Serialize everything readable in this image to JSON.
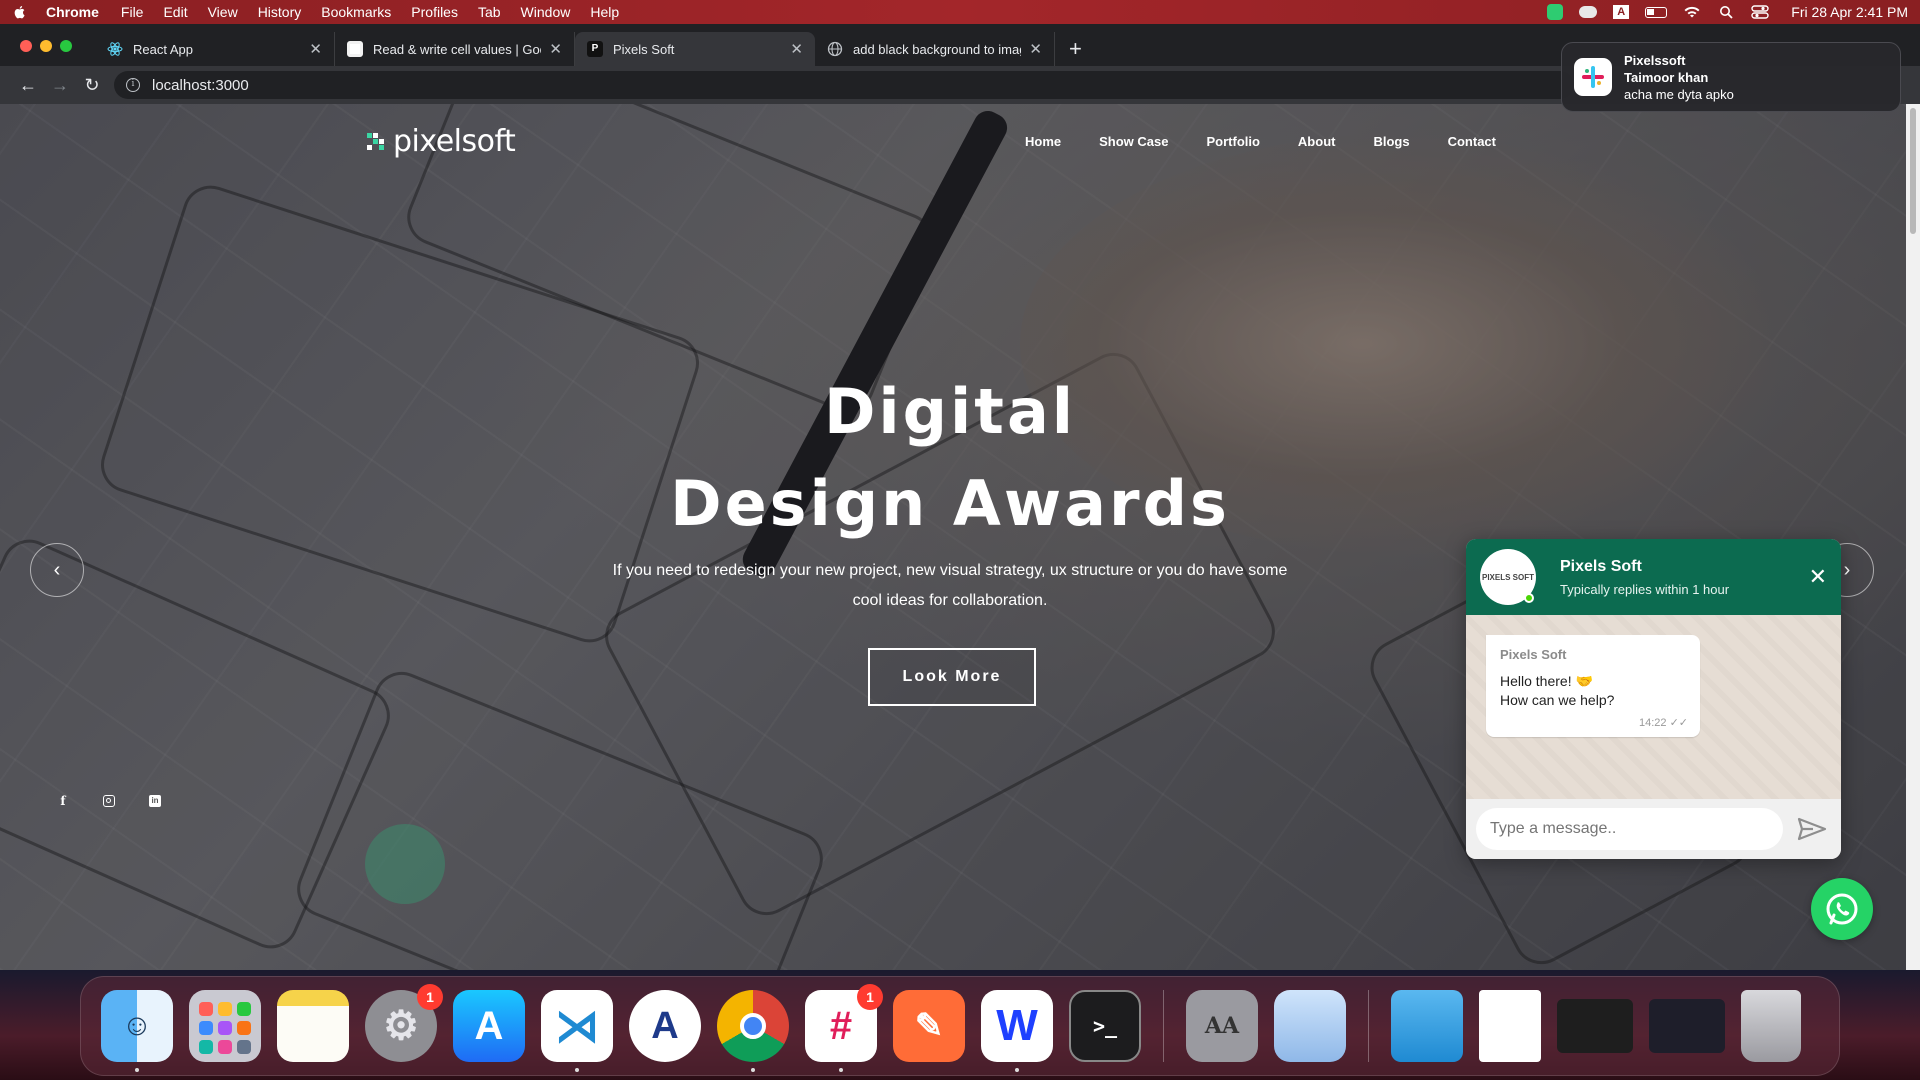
{
  "menubar": {
    "app_name": "Chrome",
    "menu_items": [
      "File",
      "Edit",
      "View",
      "History",
      "Bookmarks",
      "Profiles",
      "Tab",
      "Window",
      "Help"
    ],
    "clock": "Fri 28 Apr  2:41 PM"
  },
  "browser": {
    "tabs": [
      {
        "title": "React App",
        "icon": "react-icon"
      },
      {
        "title": "Read & write cell values  |  Goo",
        "icon": "sheets-icon"
      },
      {
        "title": "Pixels Soft",
        "icon": "pixelsoft-icon"
      },
      {
        "title": "add black background to image",
        "icon": "globe-icon"
      }
    ],
    "active_tab": 2,
    "url": "localhost:3000"
  },
  "notification": {
    "app": "Pixelssoft",
    "sender": "Taimoor khan",
    "message": "acha me dyta apko"
  },
  "site": {
    "logo_text": "pixelsoft",
    "nav": [
      "Home",
      "Show Case",
      "Portfolio",
      "About",
      "Blogs",
      "Contact"
    ],
    "hero": {
      "title_line1": "Digital",
      "title_line2": "Design Awards",
      "subtitle": "If you need to redesign your new project, new visual strategy, ux structure or you do have some cool ideas for collaboration.",
      "button": "Look More"
    },
    "social": [
      "facebook-icon",
      "instagram-icon",
      "linkedin-icon"
    ]
  },
  "whatsapp": {
    "name": "Pixels Soft",
    "status": "Typically replies within 1 hour",
    "avatar_text": "PIXELS SOFT",
    "bubble_from": "Pixels Soft",
    "bubble_line1": "Hello there! 🤝",
    "bubble_line2": "How can we help?",
    "bubble_time": "14:22",
    "input_placeholder": "Type a message..",
    "brand_color": "#0c6b50"
  },
  "dock": {
    "apps": [
      "Finder",
      "Launchpad",
      "Notes",
      "System Settings",
      "App Store",
      "Visual Studio Code",
      "Android Studio",
      "Chrome",
      "Slack",
      "Postman",
      "WebStorm",
      "Terminal",
      "Font Book",
      "Preview",
      "Downloads",
      "Document",
      "VS Code Window",
      "Slack Window",
      "Trash"
    ],
    "settings_badge": "1",
    "slack_badge": "1"
  }
}
